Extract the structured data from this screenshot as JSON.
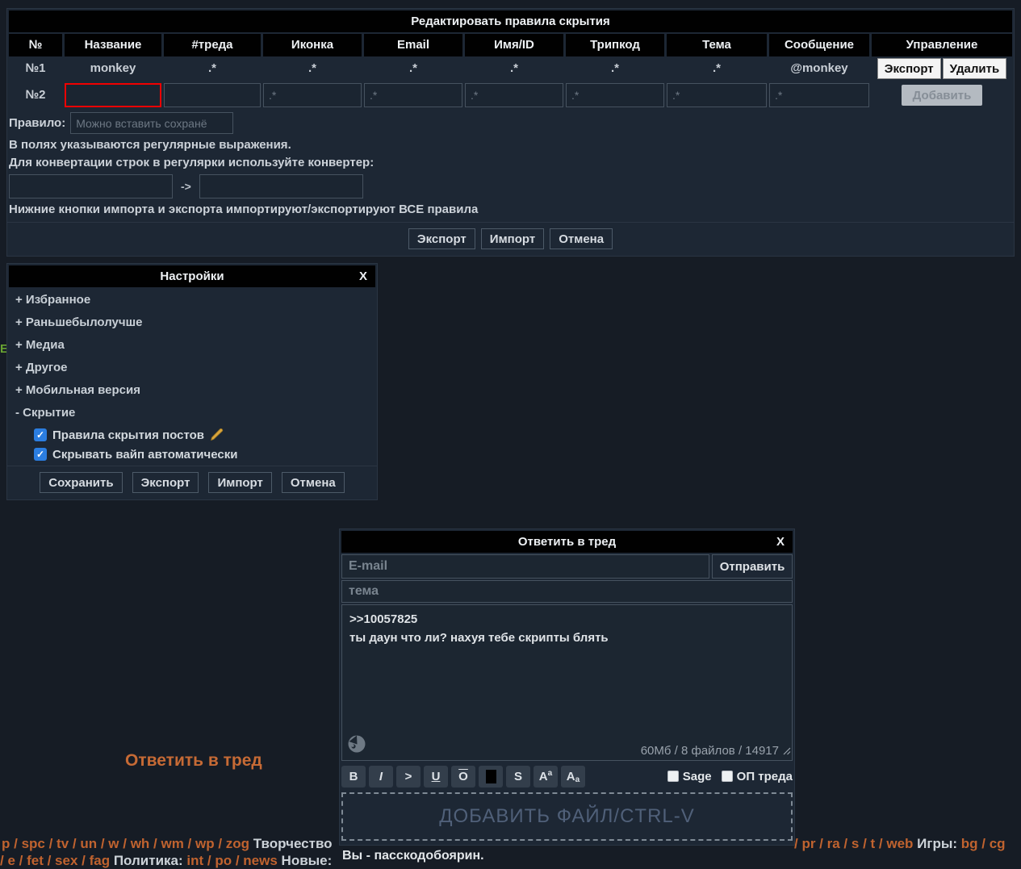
{
  "colors": {
    "page_bg": "#161c25",
    "panel_bg": "#1d2734",
    "titlebar_bg": "#010101",
    "accent_orange": "#c0632f",
    "checkbox_blue": "#2b7de0",
    "error_red": "#f20000"
  },
  "hide_rules_dialog": {
    "title": "Редактировать правила скрытия",
    "columns": [
      "№",
      "Название",
      "#треда",
      "Иконка",
      "Email",
      "Имя/ID",
      "Трипкод",
      "Тема",
      "Сообщение",
      "Управление"
    ],
    "rule_row": {
      "num": "№1",
      "name": "monkey",
      "thread": ".*",
      "icon": ".*",
      "email": ".*",
      "name_id": ".*",
      "tripcode": ".*",
      "subject": ".*",
      "comment": "@monkey",
      "export_label": "Экспорт",
      "delete_label": "Удалить"
    },
    "new_row": {
      "num": "№2",
      "icon_placeholder": ".*",
      "email_placeholder": ".*",
      "name_id_placeholder": ".*",
      "tripcode_placeholder": ".*",
      "subject_placeholder": ".*",
      "comment_placeholder": ".*",
      "add_label": "Добавить"
    },
    "rule_label": "Правило:",
    "rule_placeholder": "Можно вставить сохранё",
    "info_line1": "В полях указываются регулярные выражения.",
    "info_line2": "Для конвертации строк в регулярки используйте конвертер:",
    "converter_arrow": "->",
    "info_line3": "Нижние кнопки импорта и экспорта импортируют/экспортируют ВСЕ правила",
    "footer_buttons": [
      "Экспорт",
      "Импорт",
      "Отмена"
    ]
  },
  "settings_panel": {
    "title": "Настройки",
    "close_label": "X",
    "sections": [
      "+ Избранное",
      "+ Раньшебылолучше",
      "+ Медиа",
      "+ Другое",
      "+ Мобильная версия",
      "- Скрытие"
    ],
    "checkbox1_label": "Правила скрытия постов",
    "checkbox2_label": "Скрывать вайп автоматически",
    "checkmark": "✓",
    "footer_buttons": [
      "Сохранить",
      "Экспорт",
      "Импорт",
      "Отмена"
    ]
  },
  "reply_dialog": {
    "title": "Ответить в тред",
    "close_label": "X",
    "email_placeholder": "E-mail",
    "send_label": "Отправить",
    "subject_placeholder": "тема",
    "comment_text": ">>10057825\nты даун что ли? нахуя тебе скрипты блять",
    "limits": "60Мб / 8 файлов / 14917",
    "toolbar": [
      {
        "name": "bold",
        "glyph": "B"
      },
      {
        "name": "italic",
        "glyph": "I"
      },
      {
        "name": "quote",
        "glyph": ">"
      },
      {
        "name": "underline",
        "glyph": "U"
      },
      {
        "name": "overline",
        "glyph": "O"
      },
      {
        "name": "spoiler",
        "glyph": ""
      },
      {
        "name": "strike",
        "glyph": "S"
      },
      {
        "name": "superscript",
        "glyph": "A",
        "small": "a"
      },
      {
        "name": "subscript",
        "glyph": "A",
        "small": "a"
      }
    ],
    "sage_label": "Sage",
    "op_label": "ОП треда",
    "file_drop_label": "ДОБАВИТЬ ФАЙЛ/CTRL-V",
    "passcode_text": "Вы - пасскодобоярин."
  },
  "reply_link_label": "Ответить в тред",
  "stray_letter": "E",
  "board_nav": {
    "left_line1": [
      {
        "t": "p",
        "k": "l"
      },
      {
        "t": " / ",
        "k": "s"
      },
      {
        "t": "spc",
        "k": "l"
      },
      {
        "t": " / ",
        "k": "s"
      },
      {
        "t": "tv",
        "k": "l"
      },
      {
        "t": " / ",
        "k": "s"
      },
      {
        "t": "un",
        "k": "l"
      },
      {
        "t": " / ",
        "k": "s"
      },
      {
        "t": "w",
        "k": "l"
      },
      {
        "t": " / ",
        "k": "s"
      },
      {
        "t": "wh",
        "k": "l"
      },
      {
        "t": " / ",
        "k": "s"
      },
      {
        "t": "wm",
        "k": "l"
      },
      {
        "t": " / ",
        "k": "s"
      },
      {
        "t": "wp",
        "k": "l"
      },
      {
        "t": " / ",
        "k": "s"
      },
      {
        "t": "zog",
        "k": "l"
      },
      {
        "t": " Творчество",
        "k": "x"
      }
    ],
    "left_line2": [
      {
        "t": "/ ",
        "k": "s"
      },
      {
        "t": "e",
        "k": "l"
      },
      {
        "t": " / ",
        "k": "s"
      },
      {
        "t": "fet",
        "k": "l"
      },
      {
        "t": " / ",
        "k": "s"
      },
      {
        "t": "sex",
        "k": "l"
      },
      {
        "t": " / ",
        "k": "s"
      },
      {
        "t": "fag",
        "k": "l"
      },
      {
        "t": " Политика: ",
        "k": "x"
      },
      {
        "t": "int",
        "k": "l"
      },
      {
        "t": " / ",
        "k": "s"
      },
      {
        "t": "po",
        "k": "l"
      },
      {
        "t": " / ",
        "k": "s"
      },
      {
        "t": "news",
        "k": "l"
      },
      {
        "t": " Новые:",
        "k": "x"
      }
    ],
    "right_line1": [
      {
        "t": "/ ",
        "k": "s"
      },
      {
        "t": "pr",
        "k": "l"
      },
      {
        "t": " / ",
        "k": "s"
      },
      {
        "t": "ra",
        "k": "l"
      },
      {
        "t": " / ",
        "k": "s"
      },
      {
        "t": "s",
        "k": "l"
      },
      {
        "t": " / ",
        "k": "s"
      },
      {
        "t": "t",
        "k": "l"
      },
      {
        "t": " / ",
        "k": "s"
      },
      {
        "t": "web",
        "k": "l"
      },
      {
        "t": " Игры: ",
        "k": "x"
      },
      {
        "t": "bg",
        "k": "l"
      },
      {
        "t": " / ",
        "k": "s"
      },
      {
        "t": "cg",
        "k": "l"
      }
    ]
  }
}
